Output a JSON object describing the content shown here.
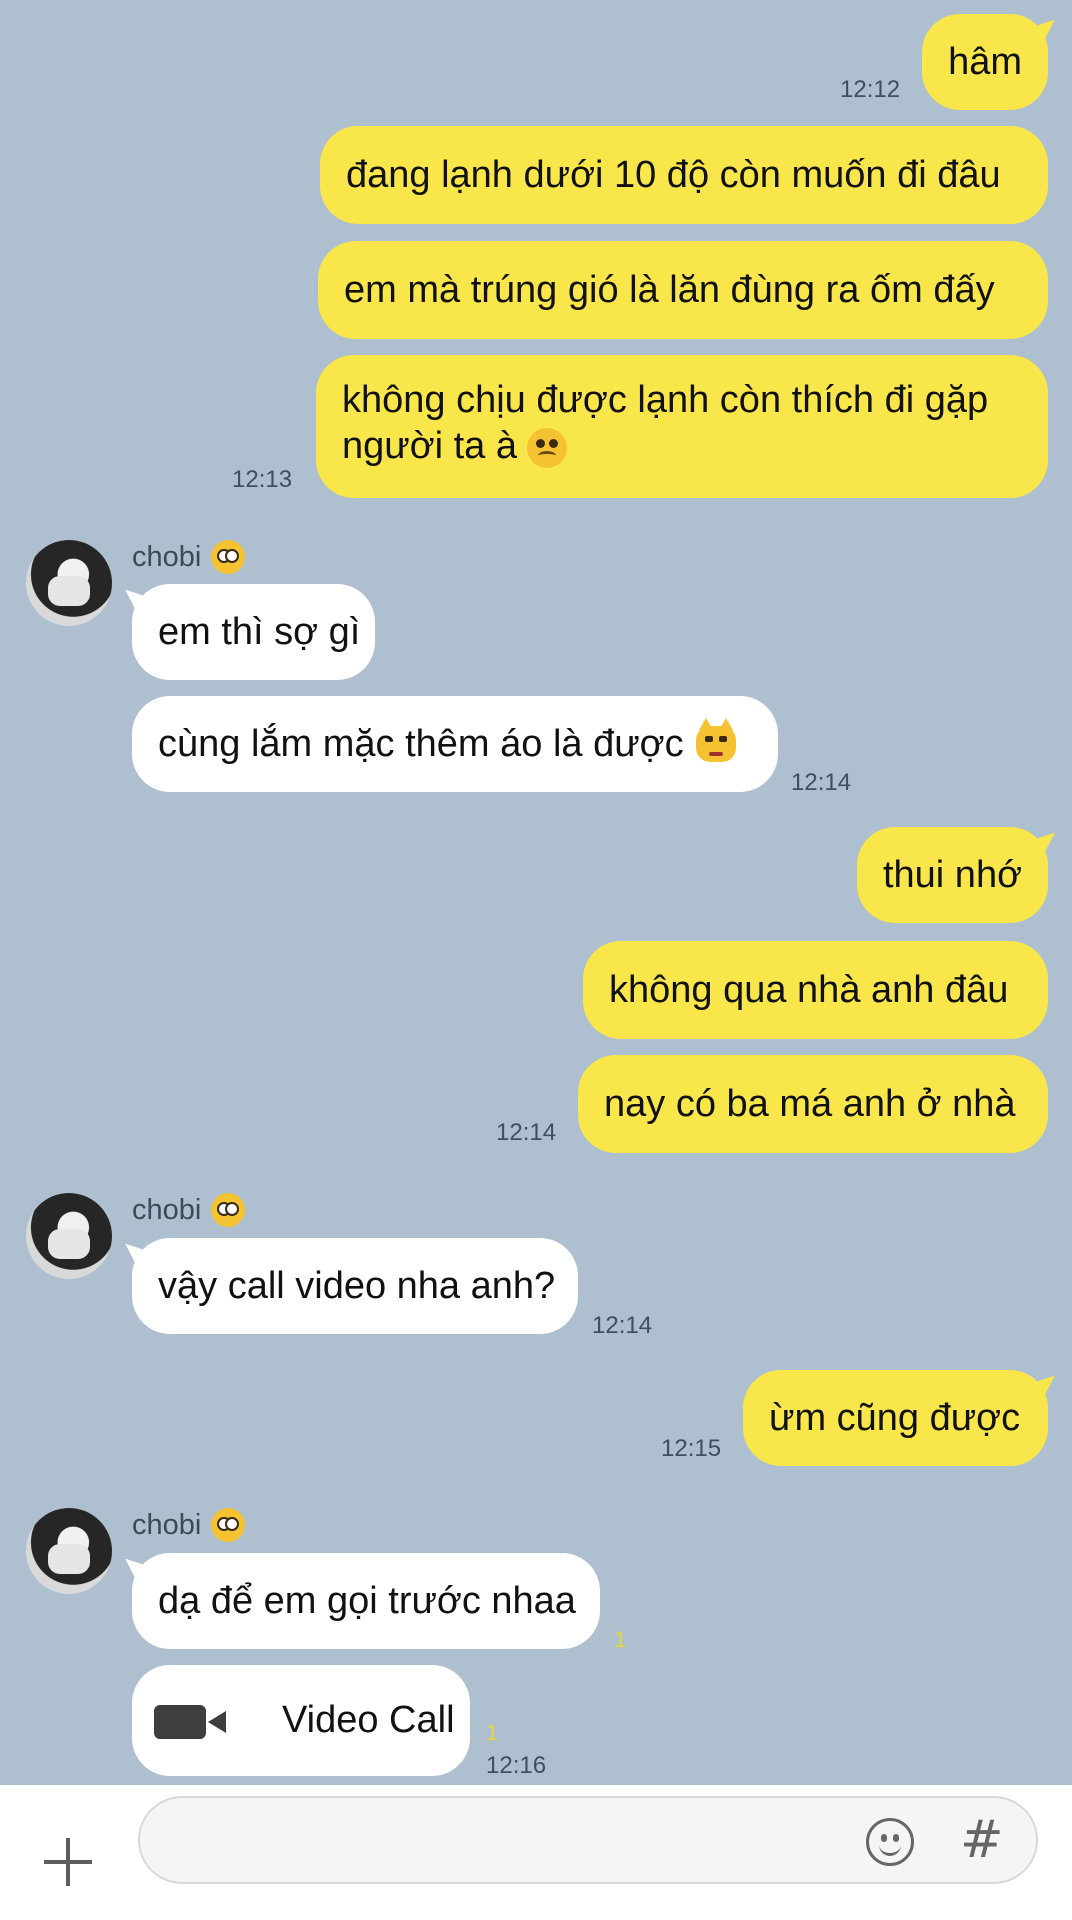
{
  "messages": {
    "m1": "hâm",
    "m2": "đang lạnh dưới 10 độ còn muốn đi đâu",
    "m3": "em mà trúng gió là lăn đùng ra ốm đấy",
    "m4": "không chịu được lạnh còn thích đi gặp người ta à",
    "t1": "12:12",
    "t2": "12:13",
    "n1": "chobi",
    "m5": "em thì sợ gì",
    "m6": "cùng lắm mặc thêm áo là được",
    "t3": "12:14",
    "m7": "thui nhớ",
    "m8": "không qua nhà anh đâu",
    "m9": "nay có ba má anh ở nhà",
    "t4": "12:14",
    "n2": "chobi",
    "m10": "vậy call video nha anh?",
    "t5": "12:14",
    "m11": "ừm cũng được",
    "t6": "12:15",
    "n3": "chobi",
    "m12": "dạ để em gọi trước nhaa",
    "u1": "1",
    "m13": "Video Call",
    "u2": "1",
    "t7": "12:16"
  },
  "composer": {
    "plus_icon": "plus-icon",
    "emoji_icon": "smile-icon",
    "hash_label": "#"
  },
  "colors": {
    "background": "#aebfcf",
    "my_bubble": "#f9e64a",
    "their_bubble": "#ffffff"
  }
}
